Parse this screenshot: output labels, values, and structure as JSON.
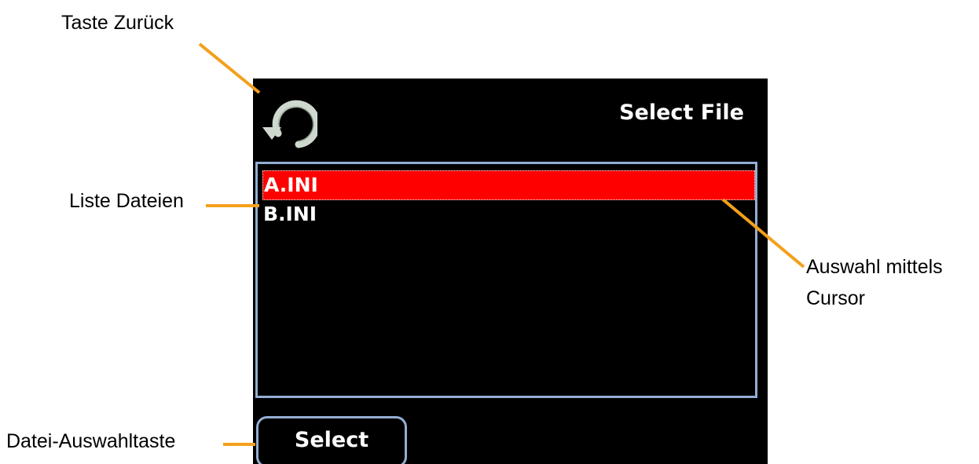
{
  "annotations": {
    "back_key": "Taste Zurück",
    "file_list": "Liste Dateien",
    "cursor_selection": "Auswahl mittels Cursor",
    "select_key": "Datei-Auswahltaste"
  },
  "screen": {
    "title": "Select File",
    "back_icon": "refresh-arrow-icon",
    "files": [
      {
        "name": "A.INI",
        "selected": true
      },
      {
        "name": "B.INI",
        "selected": false
      }
    ],
    "select_button_label": "Select"
  },
  "colors": {
    "screen_background": "#000000",
    "selection": "#ff0000",
    "frame_border": "#93aed4",
    "leader_line": "#f4a01c",
    "back_icon": "#cfd8cf"
  }
}
